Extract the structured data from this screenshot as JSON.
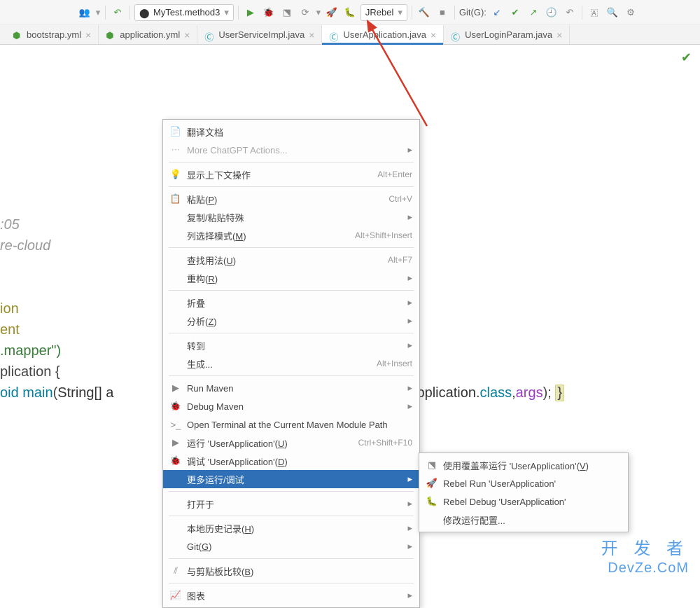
{
  "toolbar": {
    "run_config": "MyTest.method3",
    "vcs_dropdown": "JRebel",
    "git_label": " Git(G): "
  },
  "tabs": [
    {
      "label": "bootstrap.yml",
      "kind": "yml"
    },
    {
      "label": "application.yml",
      "kind": "yml"
    },
    {
      "label": "UserServiceImpl.java",
      "kind": "java"
    },
    {
      "label": "UserApplication.java",
      "kind": "java",
      "active": true
    },
    {
      "label": "UserLoginParam.java",
      "kind": "java"
    }
  ],
  "code": {
    "l1": ":05",
    "l2": "re-cloud",
    "l3": "ion",
    "l4": "ent",
    "l5_str": ".mapper\")",
    "l6a": "plication ",
    "l6b": "{",
    "l7a": "oid ",
    "l7b": "main",
    "l7c": "(",
    "l7d": "String[] a",
    "l7e": "serApplication",
    "l7f": ".",
    "l7g": "class",
    "l7h": ",",
    "l7i": "args",
    "l7j": "); ",
    "l7k": "}"
  },
  "menu": {
    "items": [
      {
        "icon": "doc",
        "text": "翻译文档"
      },
      {
        "icon": "dots",
        "text": "More ChatGPT Actions...",
        "arrow": true,
        "dim": true
      },
      {
        "sep": true
      },
      {
        "icon": "bulb",
        "text": "显示上下文操作",
        "shortcut": "Alt+Enter"
      },
      {
        "sep": true
      },
      {
        "icon": "paste",
        "text": "粘贴(P)",
        "shortcut": "Ctrl+V",
        "u": "P"
      },
      {
        "text": "复制/粘贴特殊",
        "arrow": true
      },
      {
        "text": "列选择模式(M)",
        "shortcut": "Alt+Shift+Insert",
        "u": "M"
      },
      {
        "sep": true
      },
      {
        "text": "查找用法(U)",
        "shortcut": "Alt+F7",
        "u": "U"
      },
      {
        "text": "重构(R)",
        "arrow": true,
        "u": "R"
      },
      {
        "sep": true
      },
      {
        "text": "折叠",
        "arrow": true
      },
      {
        "text": "分析(Z)",
        "arrow": true,
        "u": "Z"
      },
      {
        "sep": true
      },
      {
        "text": "转到",
        "arrow": true
      },
      {
        "text": "生成...",
        "shortcut": "Alt+Insert"
      },
      {
        "sep": true
      },
      {
        "icon": "maven-run",
        "text": "Run Maven",
        "arrow": true
      },
      {
        "icon": "maven-debug",
        "text": "Debug Maven",
        "arrow": true
      },
      {
        "icon": "terminal",
        "text": "Open Terminal at the Current Maven Module Path"
      },
      {
        "icon": "run",
        "text": "运行 'UserApplication'(U)",
        "shortcut": "Ctrl+Shift+F10",
        "u": "U"
      },
      {
        "icon": "debug",
        "text": "调试 'UserApplication'(D)",
        "u": "D"
      },
      {
        "text": "更多运行/调试",
        "arrow": true,
        "sel": true
      },
      {
        "sep": true
      },
      {
        "text": "打开于",
        "arrow": true
      },
      {
        "sep": true
      },
      {
        "text": "本地历史记录(H)",
        "arrow": true,
        "u": "H"
      },
      {
        "text": "Git(G)",
        "arrow": true,
        "u": "G"
      },
      {
        "sep": true
      },
      {
        "icon": "diff",
        "text": "与剪贴板比较(B)",
        "u": "B"
      },
      {
        "sep": true
      },
      {
        "icon": "chart",
        "text": "图表",
        "arrow": true
      }
    ]
  },
  "submenu": {
    "items": [
      {
        "icon": "coverage",
        "text": "使用覆盖率运行 'UserApplication'(V)",
        "u": "V"
      },
      {
        "icon": "rebel-run",
        "text": "Rebel Run 'UserApplication'"
      },
      {
        "icon": "rebel-debug",
        "text": "Rebel Debug 'UserApplication'"
      },
      {
        "text": "修改运行配置..."
      }
    ]
  },
  "watermark": {
    "l1": "开 发 者",
    "l2": "DevZe.CoM"
  }
}
